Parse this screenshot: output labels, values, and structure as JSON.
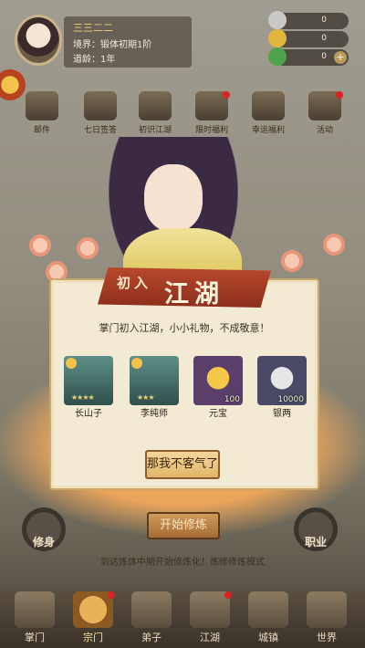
{
  "player": {
    "name": "三三二二",
    "realm": "境界：锻体初期1阶",
    "age": "道龄：1年"
  },
  "currencies": [
    {
      "icon": "silver-ingot-icon",
      "value": "0",
      "color": "#c9c9c9",
      "has_plus": false
    },
    {
      "icon": "gold-ingot-icon",
      "value": "0",
      "color": "#e2b53e",
      "has_plus": false
    },
    {
      "icon": "jade-icon",
      "value": "0",
      "color": "#4fa34a",
      "has_plus": true
    }
  ],
  "features": [
    {
      "label": "邮件",
      "dot": false
    },
    {
      "label": "七日签答",
      "dot": false
    },
    {
      "label": "初识江湖",
      "dot": false
    },
    {
      "label": "限时福利",
      "dot": true
    },
    {
      "label": "幸运福利",
      "dot": false
    },
    {
      "label": "活动",
      "dot": true
    }
  ],
  "dialog": {
    "title_small": "初入",
    "title_big": "江湖",
    "message": "掌门初入江湖，小小礼物，不成敬意！",
    "accept_label": "那我不客气了"
  },
  "rewards": [
    {
      "label": "长山子",
      "qty": "",
      "kind": "hero",
      "color": "#3e6b66"
    },
    {
      "label": "李纯师",
      "qty": "",
      "kind": "hero",
      "color": "#3e6b66"
    },
    {
      "label": "元宝",
      "qty": "100",
      "kind": "gold",
      "color": "#5a3f6b"
    },
    {
      "label": "银两",
      "qty": "10000",
      "kind": "silver",
      "color": "#4a4a66"
    }
  ],
  "main": {
    "start_label": "开始修炼",
    "left_label": "修身",
    "right_label": "职业",
    "hint": "到达炼体中期开始修炼化！炼修修炼模式"
  },
  "nav": [
    {
      "label": "掌门",
      "active": false,
      "dot": false
    },
    {
      "label": "宗门",
      "active": true,
      "dot": true
    },
    {
      "label": "弟子",
      "active": false,
      "dot": false
    },
    {
      "label": "江湖",
      "active": false,
      "dot": true
    },
    {
      "label": "城镇",
      "active": false,
      "dot": false
    },
    {
      "label": "世界",
      "active": false,
      "dot": false
    }
  ],
  "colors": {
    "accent_red": "#b9492c",
    "dialog_bg": "#f3ead3",
    "fog": "#f1a85a"
  }
}
